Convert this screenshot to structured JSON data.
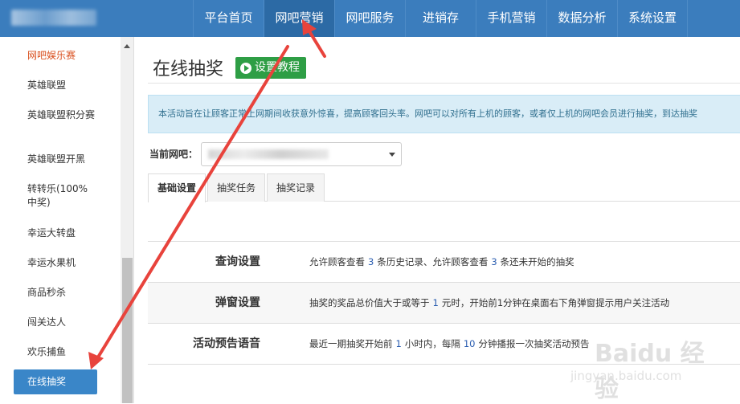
{
  "header": {
    "nav": [
      {
        "label": "平台首页"
      },
      {
        "label": "网吧营销",
        "active": true
      },
      {
        "label": "网吧服务"
      },
      {
        "label": "进销存"
      },
      {
        "label": "手机营销"
      },
      {
        "label": "数据分析"
      },
      {
        "label": "系统设置"
      }
    ]
  },
  "sidebar": {
    "items": [
      {
        "label": "网吧娱乐赛"
      },
      {
        "label": "英雄联盟"
      },
      {
        "label": "英雄联盟积分赛"
      },
      {
        "label": "英雄联盟开黑"
      },
      {
        "label": "转转乐(100%中奖)"
      },
      {
        "label": "幸运大转盘"
      },
      {
        "label": "幸运水果机"
      },
      {
        "label": "商品秒杀"
      },
      {
        "label": "闯关达人"
      },
      {
        "label": "欢乐捕鱼"
      },
      {
        "label": "在线抽奖"
      }
    ]
  },
  "main": {
    "title": "在线抽奖",
    "tutorial_button": "设置教程",
    "info": "本活动旨在让顾客正常上网期间收获意外惊喜，提高顾客回头率。网吧可以对所有上机的顾客，或者仅上机的网吧会员进行抽奖，到达抽奖",
    "bar_label": "当前网吧：",
    "tabs": [
      {
        "label": "基础设置"
      },
      {
        "label": "抽奖任务"
      },
      {
        "label": "抽奖记录"
      }
    ],
    "settings": {
      "query": {
        "label": "查询设置",
        "t1": "允许顾客查看",
        "n1": "3",
        "t2": "条历史记录、允许顾客查看",
        "n2": "3",
        "t3": "条还未开始的抽奖"
      },
      "popup": {
        "label": "弹窗设置",
        "t1": "抽奖的奖品总价值大于或等于",
        "n1": "1",
        "t2": "元时，开始前1分钟在桌面右下角弹窗提示用户关注活动"
      },
      "voice": {
        "label": "活动预告语音",
        "t1": "最近一期抽奖开始前",
        "n1": "1",
        "t2": "小时内，每隔",
        "n2": "10",
        "t3": "分钟播报一次抽奖活动预告"
      }
    }
  },
  "watermark": {
    "text": "Baidu 经验",
    "sub": "jingyan.baidu.com"
  },
  "colors": {
    "topbar": "#3b7dbd",
    "nav_active": "#2c6aa5",
    "sidebar_active": "#3a86c8",
    "tutorial_button": "#2e9e45",
    "info_bg": "#d9edf7",
    "annotation_arrow": "#e8433c"
  }
}
